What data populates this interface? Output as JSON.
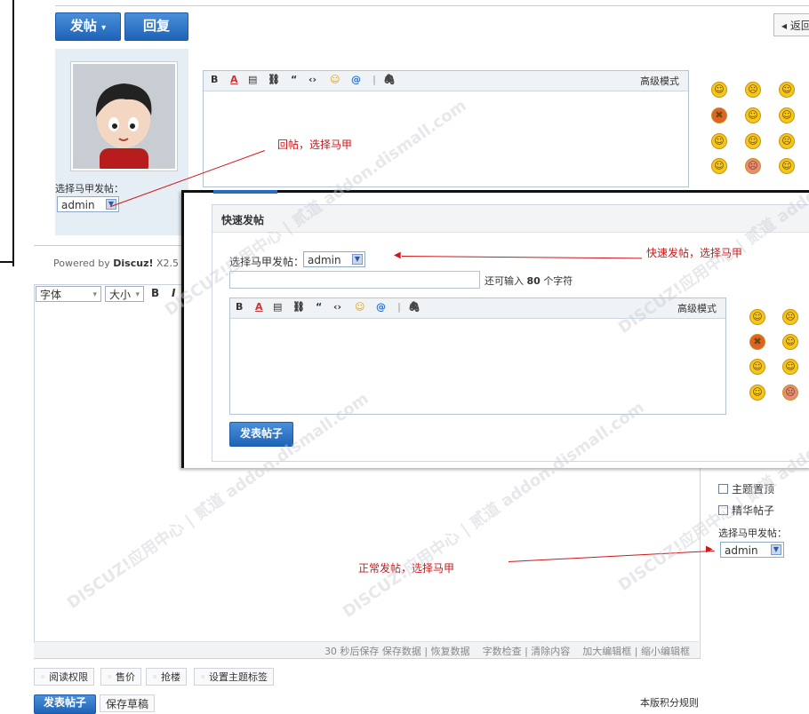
{
  "reply_panel": {
    "post_button": "发帖",
    "post_button_arrow": "▾",
    "reply_button": "回复",
    "back_button": "◂ 返回",
    "sockpuppet_label": "选择马甲发帖：",
    "sockpuppet_value": "admin",
    "advanced_mode": "高级模式",
    "annotation": "回帖，选择马甲",
    "powered_by": "Powered by",
    "powered_brand": "Discuz!",
    "powered_version": "X2.5"
  },
  "quick_post": {
    "title": "快速发帖",
    "sockpuppet_label": "选择马甲发帖：",
    "sockpuppet_value": "admin",
    "remaining_prefix": "还可输入",
    "remaining_count": "80",
    "remaining_suffix": "个字符",
    "advanced_mode": "高级模式",
    "submit_button": "发表帖子",
    "annotation": "快速发帖，选择马甲"
  },
  "normal_post": {
    "font_select": "字体",
    "size_select": "大小",
    "bold": "B",
    "italic": "I",
    "sticky_label": "主题置顶",
    "digest_label": "精华帖子",
    "sockpuppet_label": "选择马甲发帖：",
    "sockpuppet_value": "admin",
    "annotation": "正常发帖，选择马甲",
    "bottom_bar": "30 秒后保存 保存数据 | 恢复数据    字数检查 | 清除内容    加大编辑框 | 缩小编辑框",
    "tags": [
      "阅读权限",
      "售价",
      "抢楼",
      "设置主题标签"
    ],
    "submit_button": "发表帖子",
    "save_draft": "保存草稿",
    "credit_rules": "本版积分规则"
  },
  "toolbar_glyphs": [
    "B",
    "A",
    "▤",
    "⛓",
    "“",
    "‹›",
    "☺",
    "@",
    "|",
    "🖇"
  ],
  "watermark": "DISCUZ!应用中心 | 贰道 addon.dismall.com",
  "colors": {
    "annotation_red": "#d0161a",
    "button_blue": "#1f63b8"
  }
}
